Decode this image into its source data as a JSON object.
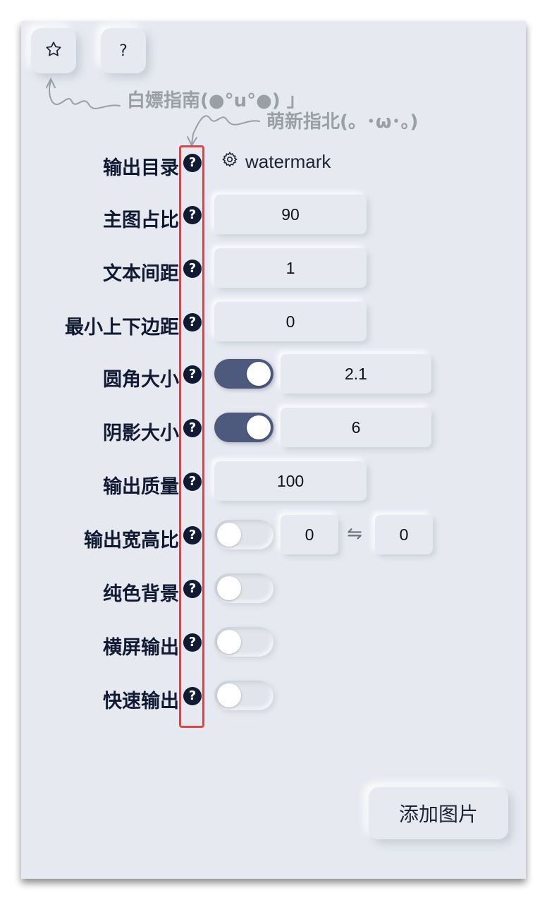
{
  "toolbar": {
    "star_icon": "star-icon",
    "help_label": "?"
  },
  "hints": {
    "hint1": "白嫖指南(●°u°●) 」",
    "hint2": "萌新指北(。･ω･。)"
  },
  "settings": {
    "output_dir": {
      "label": "输出目录",
      "value": "watermark"
    },
    "main_ratio": {
      "label": "主图占比",
      "value": "90"
    },
    "text_spacing": {
      "label": "文本间距",
      "value": "1"
    },
    "min_margin": {
      "label": "最小上下边距",
      "value": "0"
    },
    "corner_radius": {
      "label": "圆角大小",
      "enabled": true,
      "value": "2.1"
    },
    "shadow_size": {
      "label": "阴影大小",
      "enabled": true,
      "value": "6"
    },
    "quality": {
      "label": "输出质量",
      "value": "100"
    },
    "aspect_ratio": {
      "label": "输出宽高比",
      "enabled": false,
      "width": "0",
      "swap_symbol": "⇋",
      "height": "0"
    },
    "solid_bg": {
      "label": "纯色背景",
      "enabled": false
    },
    "landscape": {
      "label": "横屏输出",
      "enabled": false
    },
    "fast_output": {
      "label": "快速输出",
      "enabled": false
    }
  },
  "help_icon_glyph": "?",
  "add_button": {
    "label": "添加图片"
  },
  "colors": {
    "panel_bg": "#e6e9f0",
    "label_text": "#101a33",
    "toggle_on": "#4d5a7e",
    "highlight": "#d84848",
    "hint_text": "#9a9ea6"
  }
}
